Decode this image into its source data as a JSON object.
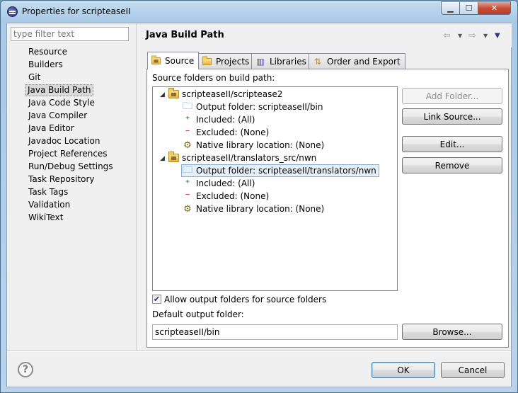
{
  "window": {
    "title": "Properties for scripteaseII"
  },
  "filter": {
    "placeholder": "type filter text"
  },
  "nav": {
    "items": [
      "Resource",
      "Builders",
      "Git",
      "Java Build Path",
      "Java Code Style",
      "Java Compiler",
      "Java Editor",
      "Javadoc Location",
      "Project References",
      "Run/Debug Settings",
      "Task Repository",
      "Task Tags",
      "Validation",
      "WikiText"
    ],
    "selected": "Java Build Path"
  },
  "page": {
    "title": "Java Build Path"
  },
  "tabs": [
    {
      "label": "Source",
      "icon": "source-folder-icon",
      "active": true
    },
    {
      "label": "Projects",
      "icon": "project-icon",
      "active": false
    },
    {
      "label": "Libraries",
      "icon": "libraries-icon",
      "active": false
    },
    {
      "label": "Order and Export",
      "icon": "order-export-icon",
      "active": false
    }
  ],
  "source": {
    "heading": "Source folders on build path:",
    "tree": [
      {
        "label": "scripteaseII/scriptease2",
        "children": [
          "Output folder: scripteaseII/bin",
          "Included: (All)",
          "Excluded: (None)",
          "Native library location: (None)"
        ]
      },
      {
        "label": "scripteaseII/translators_src/nwn",
        "children": [
          "Output folder: scripteaseII/translators/nwn",
          "Included: (All)",
          "Excluded: (None)",
          "Native library location: (None)"
        ]
      }
    ],
    "buttons": {
      "add_folder": "Add Folder...",
      "link_source": "Link Source...",
      "edit": "Edit...",
      "remove": "Remove"
    },
    "allow_output_label": "Allow output folders for source folders",
    "allow_output_checked": true,
    "default_output_label": "Default output folder:",
    "default_output_value": "scripteaseII/bin",
    "browse": "Browse..."
  },
  "footer": {
    "ok": "OK",
    "cancel": "Cancel"
  }
}
